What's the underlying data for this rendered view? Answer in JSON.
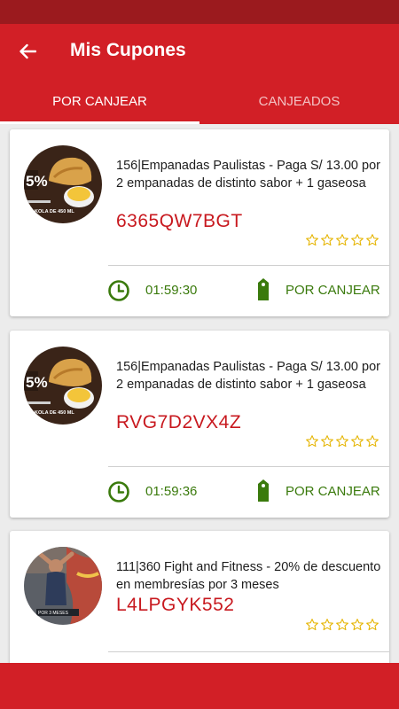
{
  "appbar": {
    "title": "Mis Cupones"
  },
  "tabs": [
    {
      "label": "POR CANJEAR",
      "active": true
    },
    {
      "label": "CANJEADOS",
      "active": false
    }
  ],
  "colors": {
    "primary": "#d21f26",
    "status_bar": "#9b1a1e",
    "code": "#c8191f",
    "status_green": "#3a7a0c",
    "star": "#e5b400"
  },
  "coupons": [
    {
      "description": "156|Empanadas Paulistas - Paga S/ 13.00 por 2 empanadas de distinto sabor + 1 gaseosa",
      "code": "6365QW7BGT",
      "rating": 0,
      "timer": "01:59:30",
      "status": "POR CANJEAR",
      "image_text": "KOLA DE 450 ML"
    },
    {
      "description": "156|Empanadas Paulistas - Paga S/ 13.00 por 2 empanadas de distinto sabor + 1 gaseosa",
      "code": "RVG7D2VX4Z",
      "rating": 0,
      "timer": "01:59:36",
      "status": "POR CANJEAR",
      "image_text": "KOLA DE 450 ML"
    },
    {
      "description": "111|360 Fight and Fitness - 20% de descuento en membresías por 3 meses",
      "code": "L4LPGYK552",
      "rating": 0,
      "timer": "",
      "status": "",
      "image_text": ""
    }
  ]
}
